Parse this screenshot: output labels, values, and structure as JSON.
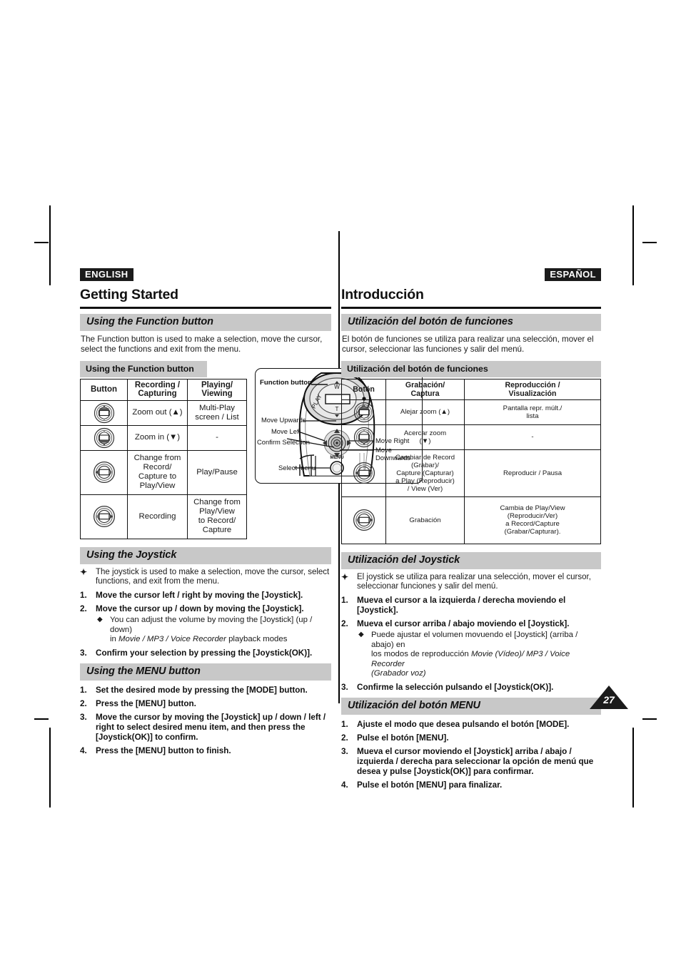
{
  "page": {
    "number": "27"
  },
  "english": {
    "lang_badge": "ENGLISH",
    "chapter_title": "Getting Started",
    "section1": {
      "heading": "Using the Function button",
      "intro": "The Function button is used to make a selection, move the cursor, select the functions and exit from the menu.",
      "table_caption": "Using the Function button",
      "columns": [
        "Button",
        "Recording /\nCapturing",
        "Playing/\nViewing"
      ],
      "col_button": "Button",
      "col_rec": "Recording /",
      "col_rec2": "Capturing",
      "col_play": "Playing/",
      "col_play2": "Viewing",
      "rows": [
        {
          "icon": "dial-up-icon",
          "rec": "Zoom out (▲)",
          "play": "Multi-Play\nscreen / List"
        },
        {
          "icon": "dial-down-icon",
          "rec": "Zoom in (▼)",
          "play": "-"
        },
        {
          "icon": "dial-left-icon",
          "rec": "Change from\nRecord/\nCapture to\nPlay/View",
          "play": "Play/Pause"
        },
        {
          "icon": "dial-right-icon",
          "rec": "Recording",
          "play": "Change from\nPlay/View\nto Record/\nCapture"
        }
      ]
    },
    "section2": {
      "heading": "Using the Joystick",
      "lead": "The joystick is used to make a selection, move the cursor, select functions, and exit from the menu.",
      "steps": [
        {
          "num": "1.",
          "text": "Move the cursor left / right by moving the [Joystick]."
        },
        {
          "num": "2.",
          "text": "Move the cursor up / down by moving the [Joystick]."
        },
        {
          "num": "3.",
          "text": "Confirm your selection by pressing the [Joystick(OK)]."
        }
      ],
      "sub_bullet_a": "You can adjust the volume by moving the [Joystick] (up / down)",
      "sub_bullet_b_pre": "in ",
      "sub_bullet_b_italic": "Movie / MP3 / Voice Recorder",
      "sub_bullet_b_post": " playback modes"
    },
    "section3": {
      "heading": "Using the MENU button",
      "steps": [
        {
          "num": "1.",
          "text": "Set the desired mode by pressing the [MODE] button."
        },
        {
          "num": "2.",
          "text": "Press the [MENU] button."
        },
        {
          "num": "3.",
          "text": "Move the cursor by moving the [Joystick] up / down / left / right to select desired menu item, and then press the [Joystick(OK)] to confirm."
        },
        {
          "num": "4.",
          "text": "Press the [MENU] button to finish."
        }
      ]
    }
  },
  "diagram": {
    "name": "camcorder-control-panel-diagram",
    "labels": {
      "function_button": "Function button",
      "move_upwards": "Move Upwards",
      "move_left": "Move Left",
      "confirm_selection": "Confirm Selection",
      "select_menu": "Select menu",
      "move_right": "Move Right",
      "move_down_1": "Move",
      "move_down_2": "Downwards"
    },
    "device_markings": {
      "play": "PLAY",
      "wide": "W",
      "tele": "T",
      "menu": "MENU"
    }
  },
  "spanish": {
    "lang_badge": "ESPAÑOL",
    "chapter_title": "Introducción",
    "section1": {
      "heading": "Utilización del botón de funciones",
      "intro": "El botón de funciones se utiliza para realizar una selección, mover el cursor, seleccionar las funciones y salir del menú.",
      "table_caption": "Utilización del botón de funciones",
      "col_button": "Botón",
      "col_rec": "Grabación/",
      "col_rec2": "Captura",
      "col_play": "Reproducción /",
      "col_play2": "Visualización",
      "rows": [
        {
          "icon": "dial-up-icon",
          "rec": "Alejar zoom (▲)",
          "play": "Pantalla repr. múlt./\nlista"
        },
        {
          "icon": "dial-down-icon",
          "rec": "Acercar zoom\n(▼)",
          "play": "-"
        },
        {
          "icon": "dial-left-icon",
          "rec": "Cambiar de Record\n(Grabar)/\nCapture (Capturar)\na Play (Reproducir)\n/ View (Ver)",
          "play": "Reproducir / Pausa"
        },
        {
          "icon": "dial-right-icon",
          "rec": "Grabación",
          "play": "Cambia de Play/View\n(Reproducir/Ver)\na Record/Capture\n(Grabar/Capturar)."
        }
      ]
    },
    "section2": {
      "heading": "Utilización del Joystick",
      "lead": "El joystick se utiliza para realizar una selección, mover el cursor, seleccionar funciones y salir del menú.",
      "steps": [
        {
          "num": "1.",
          "text": "Mueva el cursor a la izquierda / derecha moviendo el [Joystick]."
        },
        {
          "num": "2.",
          "text": "Mueva el cursor arriba / abajo moviendo el [Joystick]."
        },
        {
          "num": "3.",
          "text": "Confirme la selección pulsando el [Joystick(OK)]."
        }
      ],
      "sub_bullet_a": "Puede ajustar el volumen movuendo el [Joystick] (arriba / abajo) en",
      "sub_bullet_b_pre": "los modos de reproducción ",
      "sub_bullet_b_italic": "Movie (Vídeo)/ MP3 / Voice Recorder",
      "sub_bullet_b_post": "",
      "sub_bullet_c_italic": "(Grabador voz)"
    },
    "section3": {
      "heading": "Utilización del botón MENU",
      "steps": [
        {
          "num": "1.",
          "text": "Ajuste el modo que desea pulsando el botón [MODE]."
        },
        {
          "num": "2.",
          "text": "Pulse el botón [MENU]."
        },
        {
          "num": "3.",
          "text": "Mueva el cursor moviendo el [Joystick] arriba / abajo / izquierda / derecha para seleccionar la opción de menú que desea y pulse [Joystick(OK)] para confirmar."
        },
        {
          "num": "4.",
          "text": "Pulse el botón [MENU] para finalizar."
        }
      ]
    }
  },
  "colors": {
    "section_header_bg": "#c8c8c8",
    "badge_bg": "#1b1b1b",
    "text": "#1a1a1a",
    "rule": "#111111"
  }
}
